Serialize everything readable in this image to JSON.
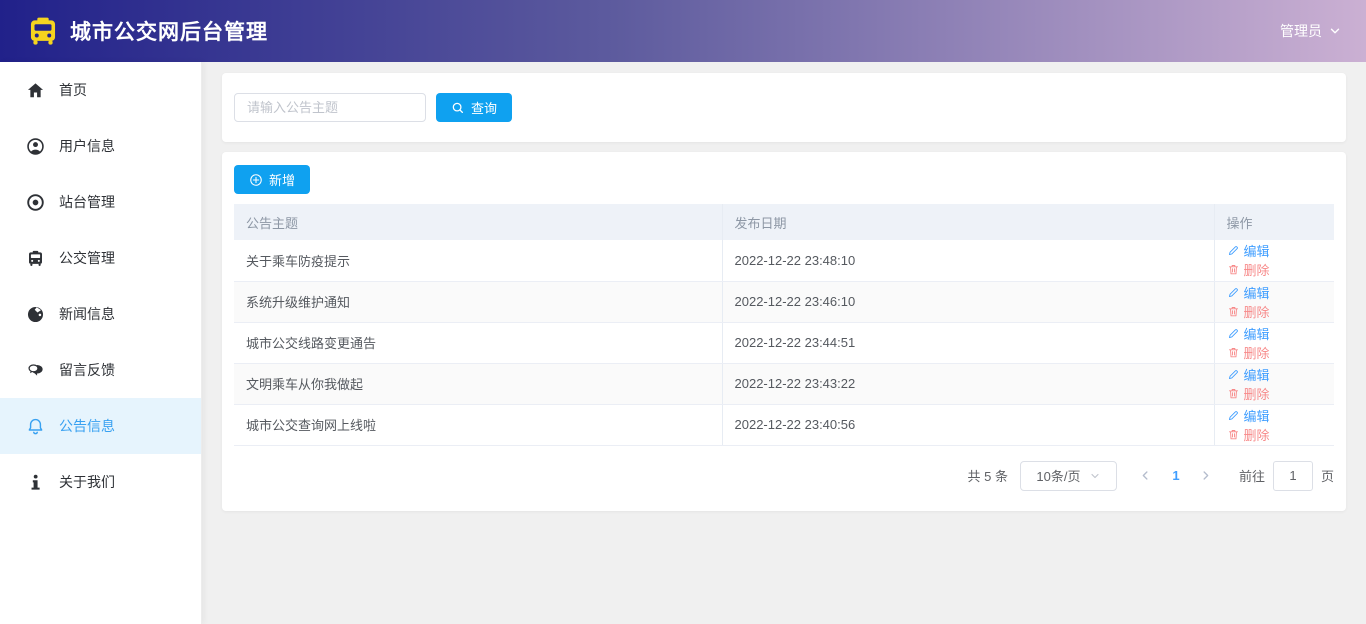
{
  "header": {
    "title": "城市公交网后台管理",
    "user_label": "管理员",
    "gradient_left": "#21218a",
    "gradient_right": "#cbb0d3",
    "bus_icon_color": "#f5d41f"
  },
  "sidebar": {
    "active_item": "公告信息",
    "active_text_color": "#38a1f1",
    "active_bg_color": "#e6f4fd",
    "items": [
      {
        "label": "首页",
        "icon": "home-icon"
      },
      {
        "label": "用户信息",
        "icon": "user-icon"
      },
      {
        "label": "站台管理",
        "icon": "station-icon"
      },
      {
        "label": "公交管理",
        "icon": "bus-icon"
      },
      {
        "label": "新闻信息",
        "icon": "globe-icon"
      },
      {
        "label": "留言反馈",
        "icon": "feedback-icon"
      },
      {
        "label": "公告信息",
        "icon": "bell-icon"
      },
      {
        "label": "关于我们",
        "icon": "info-icon"
      }
    ]
  },
  "search": {
    "placeholder": "请输入公告主题",
    "query_label": "查询"
  },
  "toolbar": {
    "add_label": "新增"
  },
  "table": {
    "columns": [
      "公告主题",
      "发布日期",
      "操作"
    ],
    "edit_label": "编辑",
    "delete_label": "删除",
    "rows": [
      {
        "topic": "关于乘车防疫提示",
        "date": "2022-12-22 23:48:10"
      },
      {
        "topic": "系统升级维护通知",
        "date": "2022-12-22 23:46:10"
      },
      {
        "topic": "城市公交线路变更通告",
        "date": "2022-12-22 23:44:51"
      },
      {
        "topic": "文明乘车从你我做起",
        "date": "2022-12-22 23:43:22"
      },
      {
        "topic": "城市公交查询网上线啦",
        "date": "2022-12-22 23:40:56"
      }
    ]
  },
  "pagination": {
    "total_text": "共 5 条",
    "page_size_label": "10条/页",
    "current_page": "1",
    "goto_label": "前往",
    "goto_value": "1",
    "page_unit_label": "页"
  },
  "colors": {
    "primary_button": "#0fa1f0",
    "edit_link": "#409eff",
    "delete_link": "#f78989",
    "table_header_bg": "#eef2f8",
    "main_bg": "#f0f0f0"
  }
}
